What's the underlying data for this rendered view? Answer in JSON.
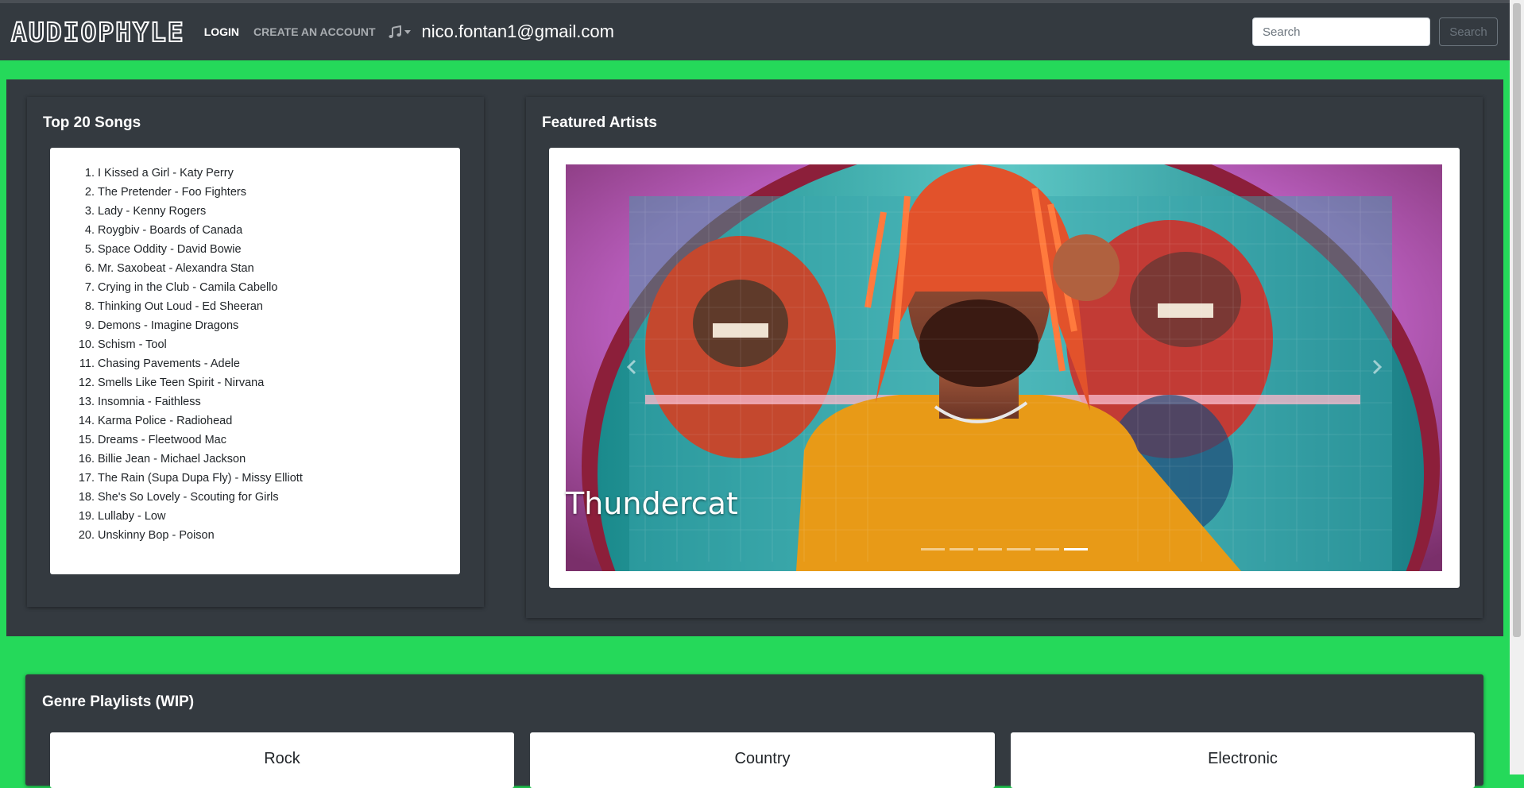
{
  "navbar": {
    "logo": "AUDIOPHYLE",
    "login": "LOGIN",
    "create_account": "CREATE AN ACCOUNT",
    "music_icon": "music-note-icon",
    "email": "nico.fontan1@gmail.com",
    "search_placeholder": "Search",
    "search_button": "Search"
  },
  "top_songs": {
    "title": "Top 20 Songs",
    "items": [
      {
        "num": "1.",
        "text": "I Kissed a Girl - Katy Perry"
      },
      {
        "num": "2.",
        "text": "The Pretender - Foo Fighters"
      },
      {
        "num": "3.",
        "text": "Lady - Kenny Rogers"
      },
      {
        "num": "4.",
        "text": "Roygbiv - Boards of Canada"
      },
      {
        "num": "5.",
        "text": "Space Oddity - David Bowie"
      },
      {
        "num": "6.",
        "text": "Mr. Saxobeat - Alexandra Stan"
      },
      {
        "num": "7.",
        "text": "Crying in the Club - Camila Cabello"
      },
      {
        "num": "8.",
        "text": "Thinking Out Loud - Ed Sheeran"
      },
      {
        "num": "9.",
        "text": "Demons - Imagine Dragons"
      },
      {
        "num": "10.",
        "text": "Schism - Tool"
      },
      {
        "num": "11.",
        "text": "Chasing Pavements - Adele"
      },
      {
        "num": "12.",
        "text": "Smells Like Teen Spirit - Nirvana"
      },
      {
        "num": "13.",
        "text": "Insomnia - Faithless"
      },
      {
        "num": "14.",
        "text": "Karma Police - Radiohead"
      },
      {
        "num": "15.",
        "text": "Dreams - Fleetwood Mac"
      },
      {
        "num": "16.",
        "text": "Billie Jean - Michael Jackson"
      },
      {
        "num": "17.",
        "text": "The Rain (Supa Dupa Fly) - Missy Elliott"
      },
      {
        "num": "18.",
        "text": "She's So Lovely - Scouting for Girls"
      },
      {
        "num": "19.",
        "text": "Lullaby - Low"
      },
      {
        "num": "20.",
        "text": "Unskinny Bop - Poison"
      }
    ]
  },
  "featured": {
    "title": "Featured Artists",
    "caption": "Thundercat",
    "indicator_count": 6,
    "active_index": 5
  },
  "genres": {
    "title": "Genre Playlists (WIP)",
    "items": [
      "Rock",
      "Country",
      "Electronic"
    ]
  },
  "colors": {
    "accent_green": "#25d95a",
    "dark_panel": "#343a40"
  }
}
